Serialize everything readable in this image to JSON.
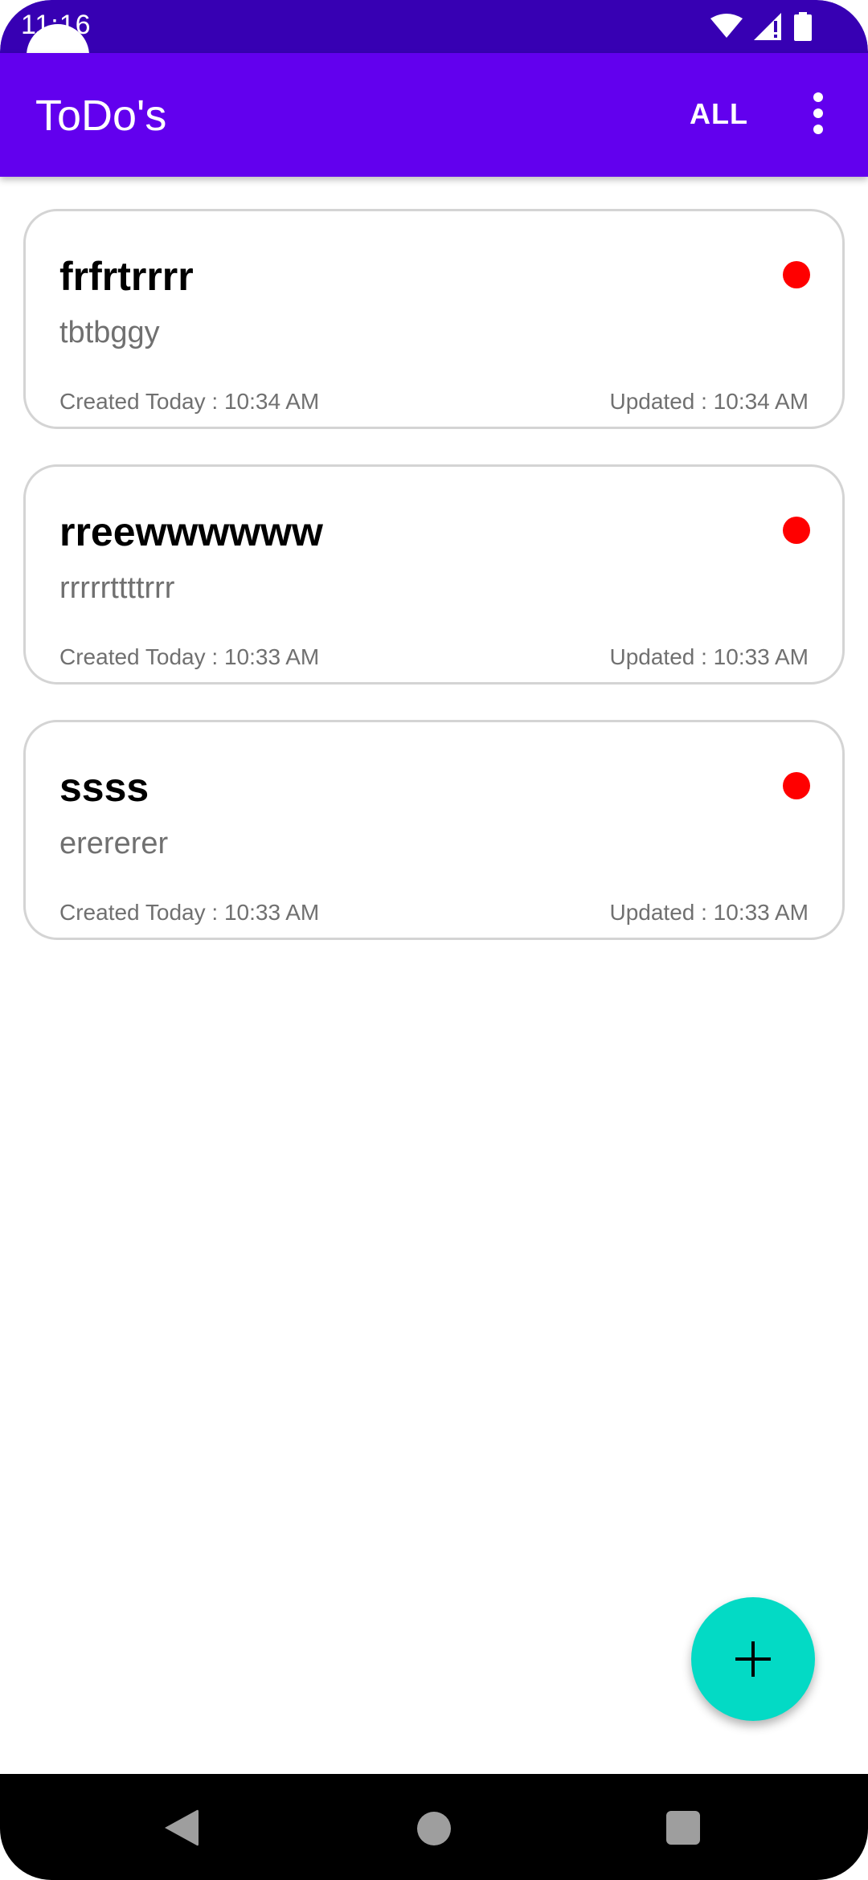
{
  "status_bar": {
    "time": "11:16",
    "icons": [
      "wifi-icon",
      "cellular-signal-icon",
      "battery-icon"
    ]
  },
  "app_bar": {
    "title": "ToDo's",
    "filter_label": "ALL",
    "overflow_icon": "more-vert-icon"
  },
  "todos": [
    {
      "title": "frfrtrrrr",
      "description": "tbtbggy",
      "created": "Created Today : 10:34 AM",
      "updated": "Updated : 10:34 AM",
      "priority_color": "#ff0000"
    },
    {
      "title": "rreewwwwww",
      "description": "rrrrrttttrrr",
      "created": "Created Today : 10:33 AM",
      "updated": "Updated : 10:33 AM",
      "priority_color": "#ff0000"
    },
    {
      "title": "ssss",
      "description": "erererer",
      "created": "Created Today : 10:33 AM",
      "updated": "Updated : 10:33 AM",
      "priority_color": "#ff0000"
    }
  ],
  "fab": {
    "icon": "add-icon"
  },
  "nav_bar": {
    "icons": [
      "back-icon",
      "home-icon",
      "recents-icon"
    ]
  },
  "colors": {
    "status_bar": "#3700b3",
    "app_bar": "#6200ee",
    "fab": "#03dac5",
    "card_border": "#d4d4d4"
  }
}
